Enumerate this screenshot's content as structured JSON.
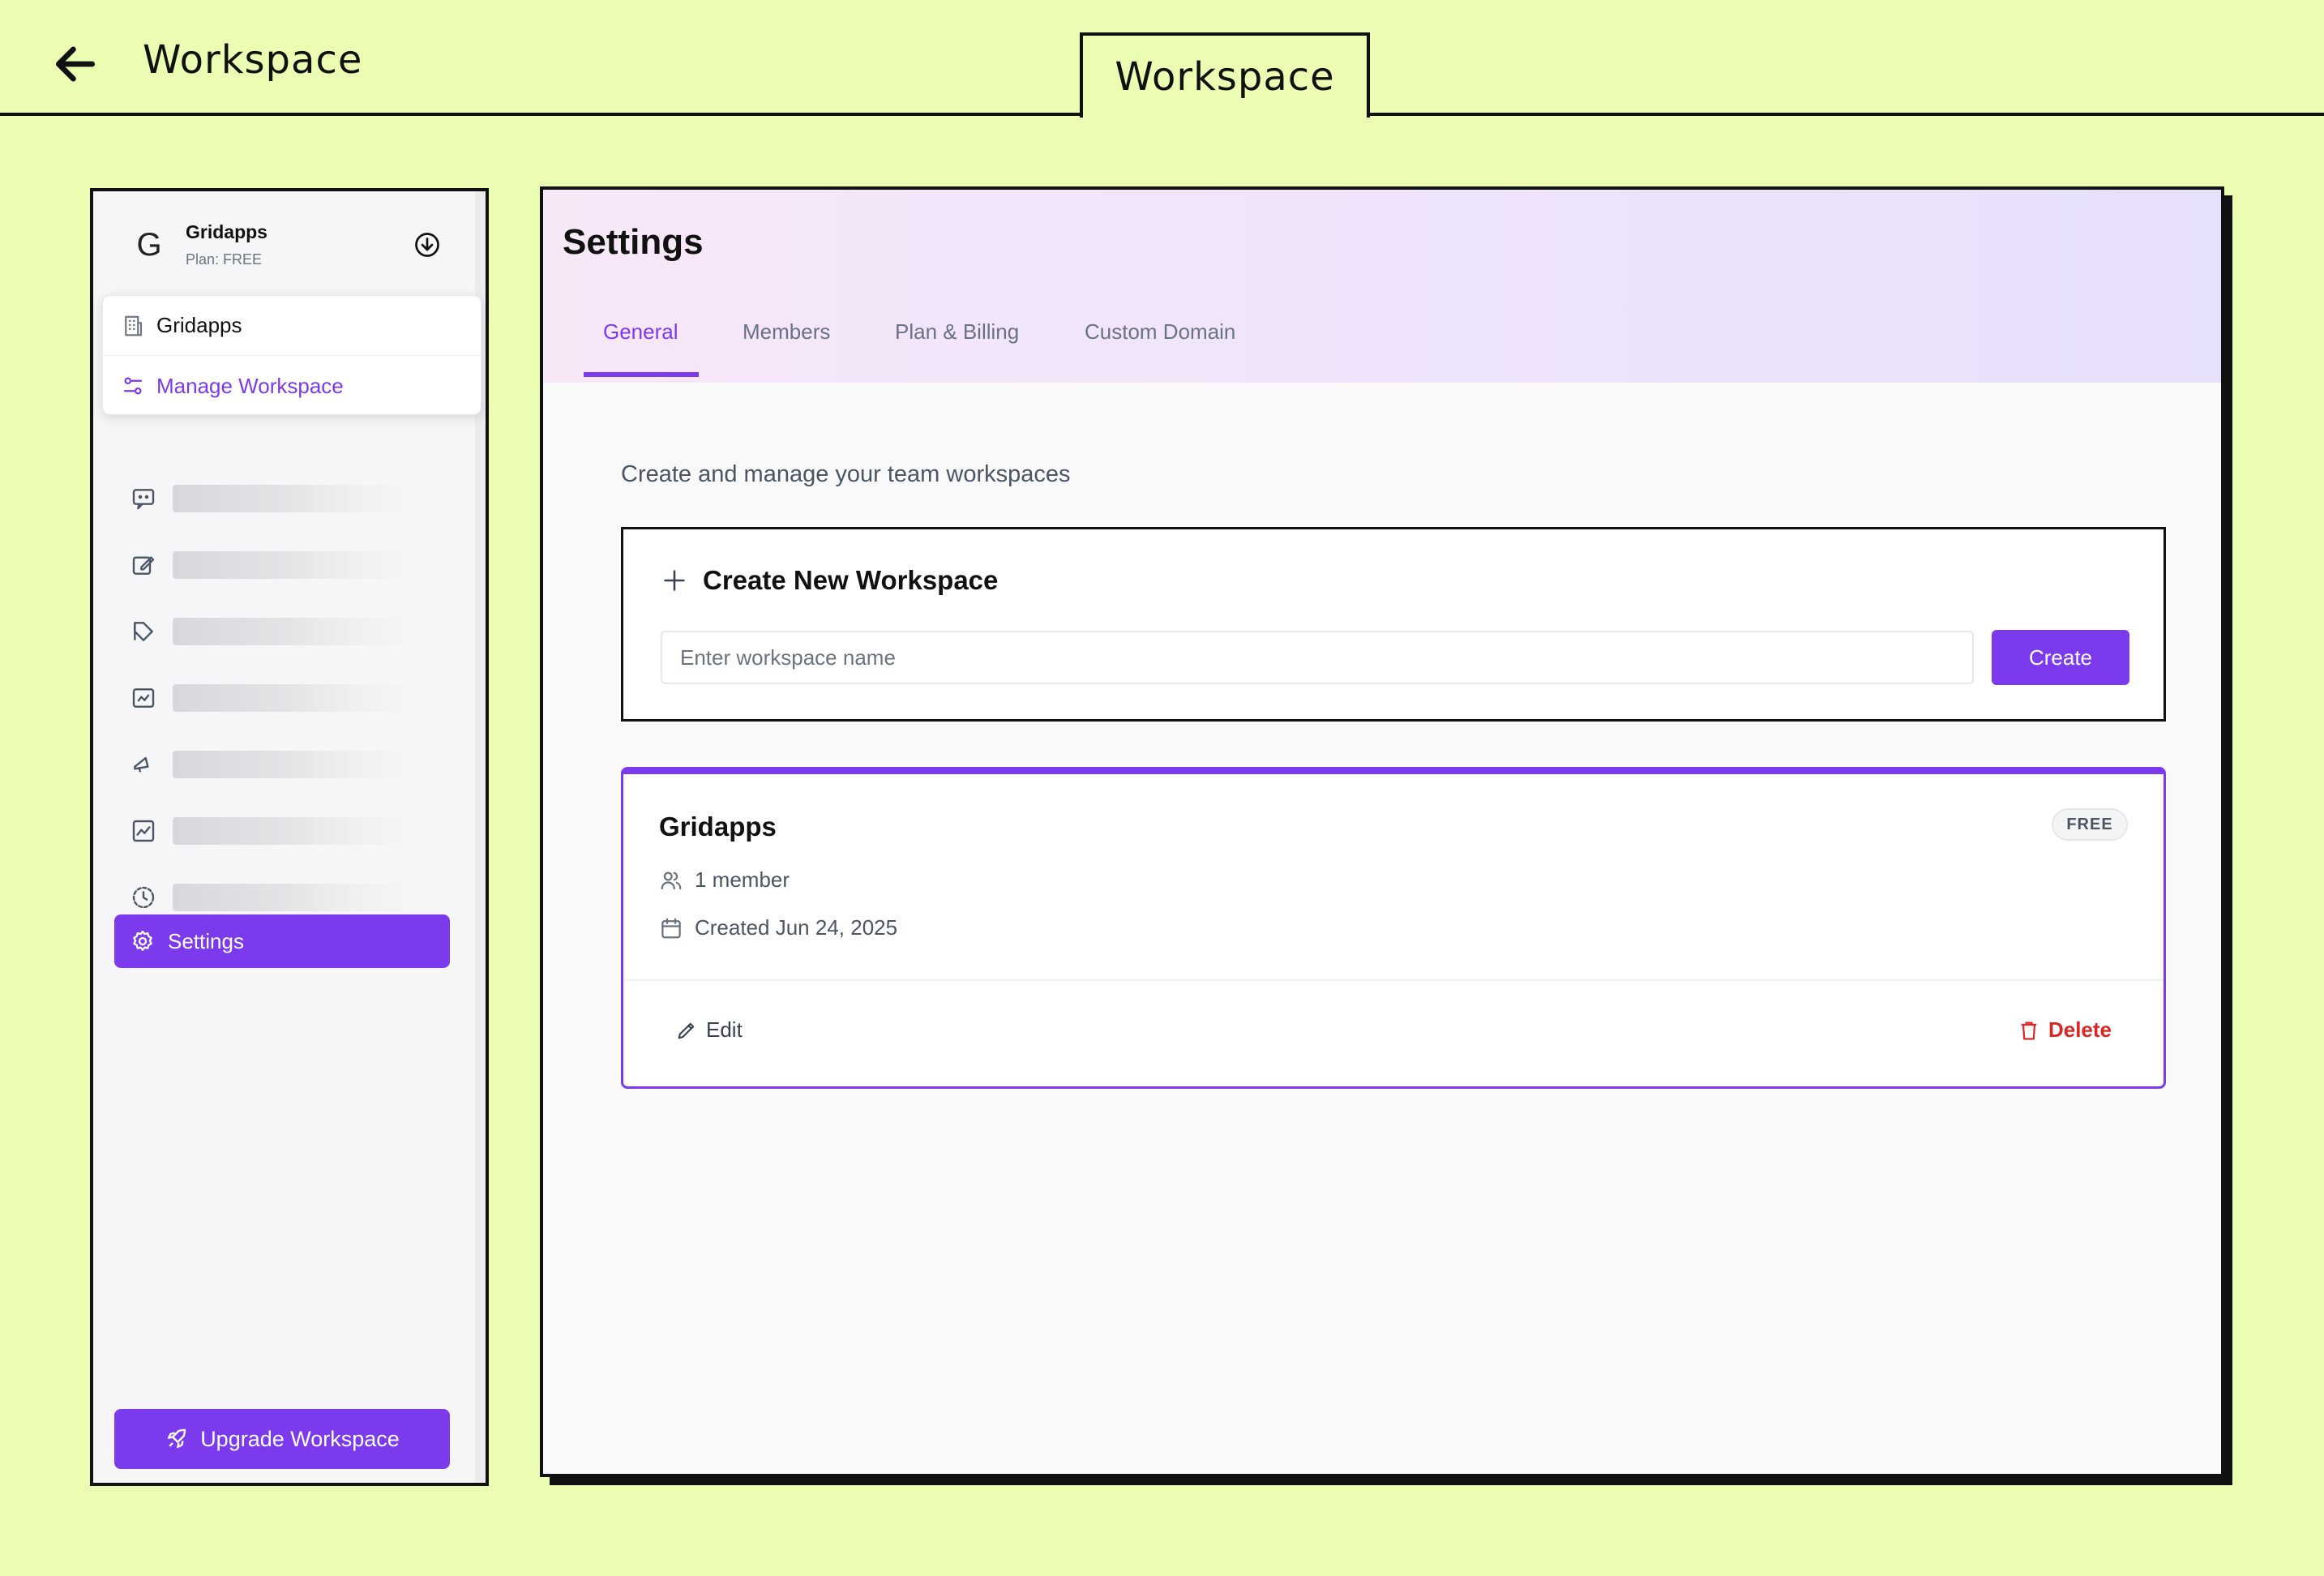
{
  "header": {
    "title": "Workspace",
    "center_tab": "Workspace",
    "back_icon": "arrow-left-icon"
  },
  "sidebar": {
    "workspace": {
      "initial": "G",
      "name": "Gridapps",
      "plan": "Plan: FREE"
    },
    "dropdown": [
      {
        "label": "Gridapps",
        "icon": "building-icon"
      },
      {
        "label": "Manage Workspace",
        "icon": "sliders-icon"
      }
    ],
    "nav_icons": [
      "chat-icon",
      "edit-icon",
      "tag-icon",
      "chart-icon",
      "megaphone-icon",
      "trend-icon",
      "clock-icon"
    ],
    "settings_label": "Settings",
    "upgrade_label": "Upgrade Workspace"
  },
  "main": {
    "title": "Settings",
    "tabs": [
      {
        "label": "General",
        "active": true
      },
      {
        "label": "Members",
        "active": false
      },
      {
        "label": "Plan & Billing",
        "active": false
      },
      {
        "label": "Custom Domain",
        "active": false
      }
    ],
    "subtitle": "Create and manage your team workspaces",
    "create": {
      "heading": "Create New Workspace",
      "placeholder": "Enter workspace name",
      "button": "Create"
    },
    "card": {
      "name": "Gridapps",
      "badge": "FREE",
      "members": "1 member",
      "created": "Created Jun 24, 2025",
      "edit_label": "Edit",
      "delete_label": "Delete"
    }
  },
  "colors": {
    "page_bg": "#ebfcb3",
    "accent": "#7c3aed",
    "danger": "#dc2626"
  }
}
